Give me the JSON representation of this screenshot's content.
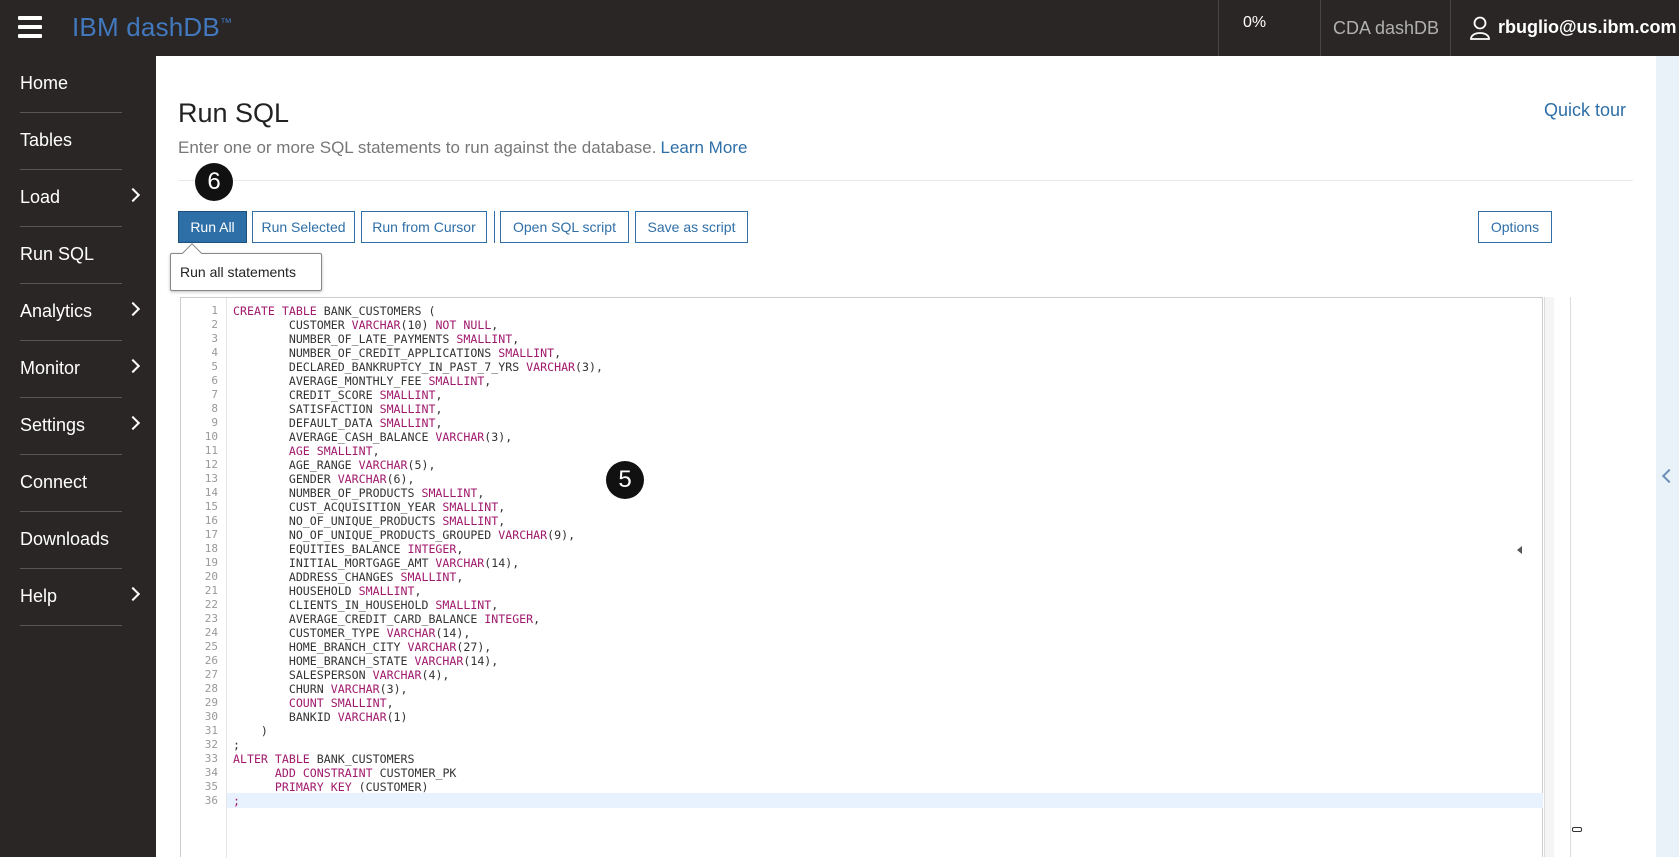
{
  "topbar": {
    "brand": "IBM dashDB",
    "brand_tm": "™",
    "progress": "0%",
    "db_name": "CDA dashDB",
    "user": "rbuglio@us.ibm.com"
  },
  "sidebar": {
    "items": [
      {
        "label": "Home",
        "submenu": false
      },
      {
        "label": "Tables",
        "submenu": false
      },
      {
        "label": "Load",
        "submenu": true
      },
      {
        "label": "Run SQL",
        "submenu": false
      },
      {
        "label": "Analytics",
        "submenu": true
      },
      {
        "label": "Monitor",
        "submenu": true
      },
      {
        "label": "Settings",
        "submenu": true
      },
      {
        "label": "Connect",
        "submenu": false
      },
      {
        "label": "Downloads",
        "submenu": false
      },
      {
        "label": "Help",
        "submenu": true
      }
    ]
  },
  "page": {
    "title": "Run SQL",
    "subtitle": "Enter one or more SQL statements to run against the database.",
    "learn_more": "Learn More",
    "quick_tour": "Quick tour"
  },
  "toolbar": {
    "run_all": "Run All",
    "run_selected": "Run Selected",
    "run_from_cursor": "Run from Cursor",
    "open_script": "Open SQL script",
    "save_script": "Save as script",
    "options": "Options",
    "tooltip": "Run all statements"
  },
  "badges": {
    "step6": "6",
    "step5": "5"
  },
  "editor": {
    "active_line": 36,
    "lines": [
      [
        [
          "kw",
          "CREATE"
        ],
        [
          "t",
          " "
        ],
        [
          "kw",
          "TABLE"
        ],
        [
          "t",
          " BANK_CUSTOMERS ("
        ]
      ],
      [
        [
          "t",
          "        CUSTOMER "
        ],
        [
          "kw",
          "VARCHAR"
        ],
        [
          "t",
          "(10) "
        ],
        [
          "kw",
          "NOT NULL"
        ],
        [
          "t",
          ","
        ]
      ],
      [
        [
          "t",
          "        NUMBER_OF_LATE_PAYMENTS "
        ],
        [
          "kw",
          "SMALLINT"
        ],
        [
          "t",
          ","
        ]
      ],
      [
        [
          "t",
          "        NUMBER_OF_CREDIT_APPLICATIONS "
        ],
        [
          "kw",
          "SMALLINT"
        ],
        [
          "t",
          ","
        ]
      ],
      [
        [
          "t",
          "        DECLARED_BANKRUPTCY_IN_PAST_7_YRS "
        ],
        [
          "kw",
          "VARCHAR"
        ],
        [
          "t",
          "(3),"
        ]
      ],
      [
        [
          "t",
          "        AVERAGE_MONTHLY_FEE "
        ],
        [
          "kw",
          "SMALLINT"
        ],
        [
          "t",
          ","
        ]
      ],
      [
        [
          "t",
          "        CREDIT_SCORE "
        ],
        [
          "kw",
          "SMALLINT"
        ],
        [
          "t",
          ","
        ]
      ],
      [
        [
          "t",
          "        SATISFACTION "
        ],
        [
          "kw",
          "SMALLINT"
        ],
        [
          "t",
          ","
        ]
      ],
      [
        [
          "t",
          "        DEFAULT_DATA "
        ],
        [
          "kw",
          "SMALLINT"
        ],
        [
          "t",
          ","
        ]
      ],
      [
        [
          "t",
          "        AVERAGE_CASH_BALANCE "
        ],
        [
          "kw",
          "VARCHAR"
        ],
        [
          "t",
          "(3),"
        ]
      ],
      [
        [
          "t",
          "        "
        ],
        [
          "kw",
          "AGE"
        ],
        [
          "t",
          " "
        ],
        [
          "kw",
          "SMALLINT"
        ],
        [
          "t",
          ","
        ]
      ],
      [
        [
          "t",
          "        AGE_RANGE "
        ],
        [
          "kw",
          "VARCHAR"
        ],
        [
          "t",
          "(5),"
        ]
      ],
      [
        [
          "t",
          "        GENDER "
        ],
        [
          "kw",
          "VARCHAR"
        ],
        [
          "t",
          "(6),"
        ]
      ],
      [
        [
          "t",
          "        NUMBER_OF_PRODUCTS "
        ],
        [
          "kw",
          "SMALLINT"
        ],
        [
          "t",
          ","
        ]
      ],
      [
        [
          "t",
          "        CUST_ACQUISITION_YEAR "
        ],
        [
          "kw",
          "SMALLINT"
        ],
        [
          "t",
          ","
        ]
      ],
      [
        [
          "t",
          "        NO_OF_UNIQUE_PRODUCTS "
        ],
        [
          "kw",
          "SMALLINT"
        ],
        [
          "t",
          ","
        ]
      ],
      [
        [
          "t",
          "        NO_OF_UNIQUE_PRODUCTS_GROUPED "
        ],
        [
          "kw",
          "VARCHAR"
        ],
        [
          "t",
          "(9),"
        ]
      ],
      [
        [
          "t",
          "        EQUITIES_BALANCE "
        ],
        [
          "kw",
          "INTEGER"
        ],
        [
          "t",
          ","
        ]
      ],
      [
        [
          "t",
          "        INITIAL_MORTGAGE_AMT "
        ],
        [
          "kw",
          "VARCHAR"
        ],
        [
          "t",
          "(14),"
        ]
      ],
      [
        [
          "t",
          "        ADDRESS_CHANGES "
        ],
        [
          "kw",
          "SMALLINT"
        ],
        [
          "t",
          ","
        ]
      ],
      [
        [
          "t",
          "        HOUSEHOLD "
        ],
        [
          "kw",
          "SMALLINT"
        ],
        [
          "t",
          ","
        ]
      ],
      [
        [
          "t",
          "        CLIENTS_IN_HOUSEHOLD "
        ],
        [
          "kw",
          "SMALLINT"
        ],
        [
          "t",
          ","
        ]
      ],
      [
        [
          "t",
          "        AVERAGE_CREDIT_CARD_BALANCE "
        ],
        [
          "kw",
          "INTEGER"
        ],
        [
          "t",
          ","
        ]
      ],
      [
        [
          "t",
          "        CUSTOMER_TYPE "
        ],
        [
          "kw",
          "VARCHAR"
        ],
        [
          "t",
          "(14),"
        ]
      ],
      [
        [
          "t",
          "        HOME_BRANCH_CITY "
        ],
        [
          "kw",
          "VARCHAR"
        ],
        [
          "t",
          "(27),"
        ]
      ],
      [
        [
          "t",
          "        HOME_BRANCH_STATE "
        ],
        [
          "kw",
          "VARCHAR"
        ],
        [
          "t",
          "(14),"
        ]
      ],
      [
        [
          "t",
          "        SALESPERSON "
        ],
        [
          "kw",
          "VARCHAR"
        ],
        [
          "t",
          "(4),"
        ]
      ],
      [
        [
          "t",
          "        CHURN "
        ],
        [
          "kw",
          "VARCHAR"
        ],
        [
          "t",
          "(3),"
        ]
      ],
      [
        [
          "t",
          "        "
        ],
        [
          "kw",
          "COUNT"
        ],
        [
          "t",
          " "
        ],
        [
          "kw",
          "SMALLINT"
        ],
        [
          "t",
          ","
        ]
      ],
      [
        [
          "t",
          "        BANKID "
        ],
        [
          "kw",
          "VARCHAR"
        ],
        [
          "t",
          "(1)"
        ]
      ],
      [
        [
          "t",
          "    )"
        ]
      ],
      [
        [
          "t",
          ";"
        ]
      ],
      [
        [
          "kw",
          "ALTER"
        ],
        [
          "t",
          " "
        ],
        [
          "kw",
          "TABLE"
        ],
        [
          "t",
          " BANK_CUSTOMERS"
        ]
      ],
      [
        [
          "t",
          "      "
        ],
        [
          "kw",
          "ADD"
        ],
        [
          "t",
          " "
        ],
        [
          "kw",
          "CONSTRAINT"
        ],
        [
          "t",
          " CUSTOMER_PK"
        ]
      ],
      [
        [
          "t",
          "      "
        ],
        [
          "kw",
          "PRIMARY KEY"
        ],
        [
          "t",
          " (CUSTOMER)"
        ]
      ],
      [
        [
          "kw",
          ";"
        ]
      ]
    ]
  }
}
